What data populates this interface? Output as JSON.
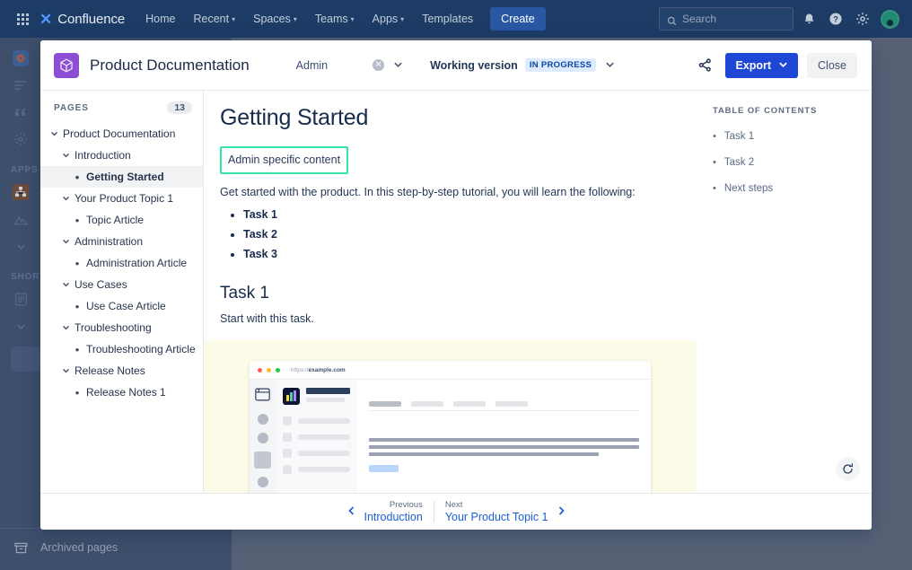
{
  "topnav": {
    "app_switcher_icon": "grid-icon",
    "brand": "Confluence",
    "items": [
      {
        "label": "Home",
        "caret": false
      },
      {
        "label": "Recent",
        "caret": true
      },
      {
        "label": "Spaces",
        "caret": true
      },
      {
        "label": "Teams",
        "caret": true
      },
      {
        "label": "Apps",
        "caret": true
      },
      {
        "label": "Templates",
        "caret": false
      }
    ],
    "create_label": "Create",
    "search_placeholder": "Search",
    "search_value": "",
    "icons": [
      "search-icon",
      "notifications-bell-icon",
      "help-icon",
      "settings-gear-icon",
      "avatar"
    ]
  },
  "background_sidebar": {
    "rows": [
      "space-home",
      "content-list",
      "blog",
      "space-settings"
    ],
    "apps_section": "APPS",
    "shortcuts_section": "SHORTCUTS",
    "archived_label": "Archived pages"
  },
  "modal": {
    "space_icon": "box-cube-icon",
    "title": "Product Documentation",
    "scope_label": "Admin",
    "clear_icon": "clear-circle-icon",
    "scope_chevron": "chevron-down-icon",
    "version_label": "Working version",
    "status_badge": "IN PROGRESS",
    "version_chevron": "chevron-down-icon",
    "share_icon": "share-icon",
    "export_label": "Export",
    "export_chevron": "chevron-down-icon",
    "close_label": "Close",
    "accent_blue": "#1e47d6",
    "badge_bg": "#deebff",
    "badge_fg": "#0747a6",
    "space_icon_color": "#8c4fd4"
  },
  "pages_panel": {
    "title": "PAGES",
    "count": "13",
    "tree": [
      {
        "label": "Product Documentation",
        "indent": 0,
        "type": "expand",
        "active": false
      },
      {
        "label": "Introduction",
        "indent": 1,
        "type": "expand",
        "active": false
      },
      {
        "label": "Getting Started",
        "indent": 2,
        "type": "bullet",
        "active": true
      },
      {
        "label": "Your Product Topic 1",
        "indent": 1,
        "type": "expand",
        "active": false
      },
      {
        "label": "Topic Article",
        "indent": 2,
        "type": "bullet",
        "active": false
      },
      {
        "label": "Administration",
        "indent": 1,
        "type": "expand",
        "active": false
      },
      {
        "label": "Administration Article",
        "indent": 2,
        "type": "bullet",
        "active": false
      },
      {
        "label": "Use Cases",
        "indent": 1,
        "type": "expand",
        "active": false
      },
      {
        "label": "Use Case Article",
        "indent": 2,
        "type": "bullet",
        "active": false
      },
      {
        "label": "Troubleshooting",
        "indent": 1,
        "type": "expand",
        "active": false
      },
      {
        "label": "Troubleshooting Article",
        "indent": 2,
        "type": "bullet",
        "active": false
      },
      {
        "label": "Release Notes",
        "indent": 1,
        "type": "expand",
        "active": false
      },
      {
        "label": "Release Notes 1",
        "indent": 2,
        "type": "bullet",
        "active": false
      }
    ]
  },
  "document": {
    "title": "Getting Started",
    "highlight_text": "Admin specific content",
    "highlight_color": "#36e4a4",
    "intro": "Get started with the product. In this step-by-step tutorial, you will learn the following:",
    "task_list": [
      "Task 1",
      "Task 2",
      "Task 3"
    ],
    "task1_heading": "Task 1",
    "task1_text": "Start with this task.",
    "mockup": {
      "url_prefix": "https://",
      "url_domain": "example.com",
      "traffic_lights": [
        "#ff5f57",
        "#febc2e",
        "#28c840"
      ],
      "chart_icon": "bar-chart-icon",
      "chart_bars": [
        "#ffd43b",
        "#4cd4a0",
        "#a78bfa"
      ],
      "background": "#fdfce8"
    },
    "refresh_icon": "refresh-icon"
  },
  "toc": {
    "title": "TABLE OF CONTENTS",
    "items": [
      "Task 1",
      "Task 2",
      "Next steps"
    ]
  },
  "footer": {
    "previous_label": "Previous",
    "previous_link": "Introduction",
    "previous_icon": "chevron-left-icon",
    "next_label": "Next",
    "next_link": "Your Product Topic 1",
    "next_icon": "chevron-right-icon"
  }
}
